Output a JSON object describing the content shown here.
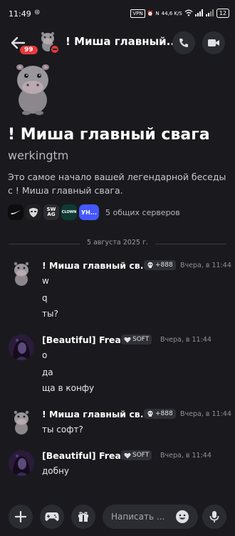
{
  "status_bar": {
    "time": "11:49",
    "speed": "44,6 K/S",
    "battery": "12"
  },
  "header": {
    "back_badge": "99",
    "title": "! Миша главный...",
    "chevron": "›"
  },
  "profile": {
    "name": "! Миша главный свага",
    "username": "werkingtm",
    "intro": "Это самое начало вашей легендарной беседы с ! Миша главный свага.",
    "servers": [
      {
        "label": ""
      },
      {
        "label": ""
      },
      {
        "label": "SW AG"
      },
      {
        "label": "CLOWN"
      },
      {
        "label": "УН..."
      }
    ],
    "mutual_servers": "5 общих серверов"
  },
  "divider": {
    "date": "5 августа 2025 г."
  },
  "messages": [
    {
      "author": "! Миша главный св...",
      "tag": "+888",
      "time": "Вчера, в 11:44",
      "lines": [
        "w",
        "q",
        "ты?"
      ]
    },
    {
      "author": "[Beautiful] Freak",
      "tag": "SOFT",
      "time": "Вчера, в 11:44",
      "lines": [
        "о",
        "да",
        "ща в конфу"
      ]
    },
    {
      "author": "! Миша главный св...",
      "tag": "+888",
      "time": "Вчера, в 11:44",
      "lines": [
        "ты софт?"
      ]
    },
    {
      "author": "[Beautiful] Freak",
      "tag": "SOFT",
      "time": "Вчера, в 11:44",
      "lines": [
        "добну"
      ]
    }
  ],
  "composer": {
    "placeholder": "Написать ..."
  },
  "colors": {
    "background": "#1a1a1e",
    "button_bg": "#2b2c31",
    "badge_red": "#e5393c",
    "blurple": "#4458ff"
  }
}
